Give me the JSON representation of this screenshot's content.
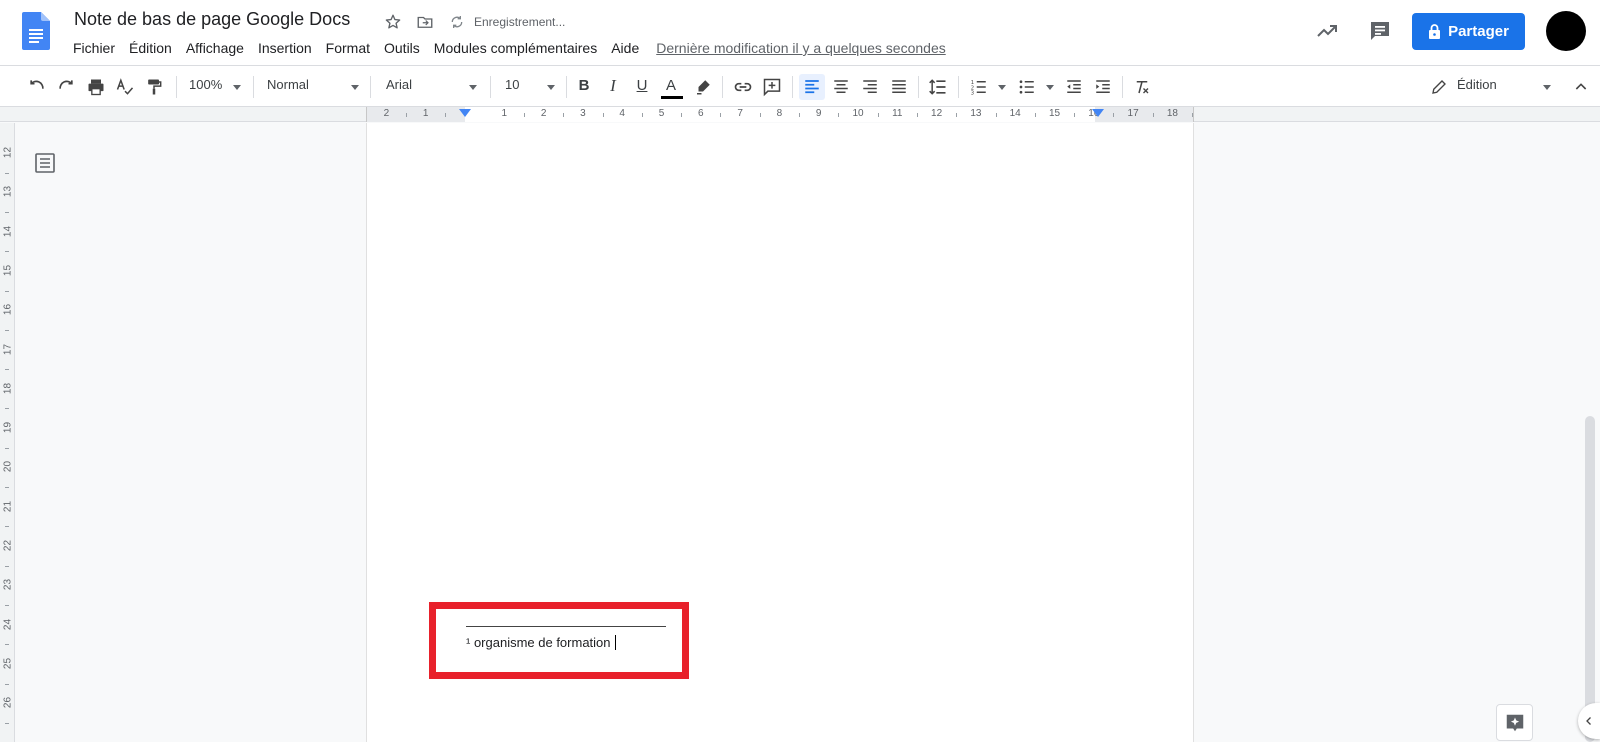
{
  "header": {
    "title": "Note de bas de page Google Docs",
    "saving_status": "Enregistrement...",
    "share_label": "Partager",
    "last_edit": "Dernière modification il y a quelques secondes",
    "menu": [
      "Fichier",
      "Édition",
      "Affichage",
      "Insertion",
      "Format",
      "Outils",
      "Modules complémentaires",
      "Aide"
    ]
  },
  "toolbar": {
    "zoom": "100%",
    "style": "Normal",
    "font": "Arial",
    "size": "10",
    "bold": "B",
    "italic": "I",
    "underline": "U",
    "text_color_letter": "A",
    "mode": "Édition",
    "text_color": "#000000"
  },
  "ruler": {
    "horizontal_numbers": [
      "2",
      "1",
      "1",
      "2",
      "3",
      "4",
      "5",
      "6",
      "7",
      "8",
      "9",
      "10",
      "11",
      "12",
      "13",
      "14",
      "15",
      "16",
      "17",
      "18"
    ],
    "vertical_numbers": [
      "12",
      "13",
      "14",
      "15",
      "16",
      "17",
      "18",
      "19",
      "20",
      "21",
      "22",
      "23",
      "24",
      "25",
      "26"
    ]
  },
  "document": {
    "footnote_text": "¹ organisme de formation"
  },
  "colors": {
    "accent": "#1a73e8",
    "highlight_box": "#e8212b",
    "docs_blue": "#4285f4"
  },
  "icons": {
    "logo": "google-docs-icon",
    "star": "star-icon",
    "move": "folder-move-icon",
    "sync": "sync-icon",
    "activity": "trending-up-icon",
    "comments": "comment-icon",
    "lock": "lock-icon"
  }
}
